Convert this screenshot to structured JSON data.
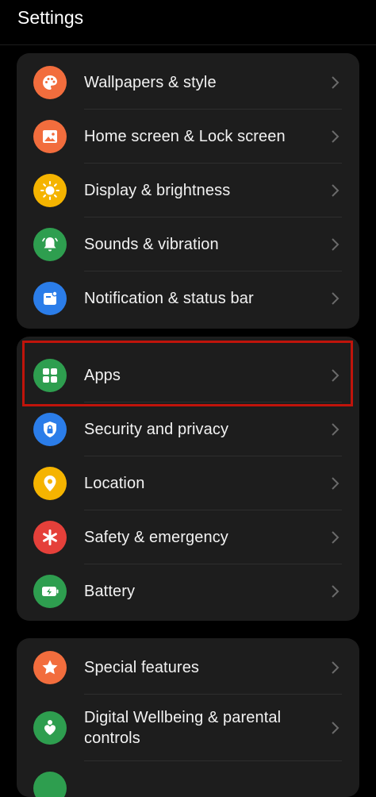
{
  "header": {
    "title": "Settings"
  },
  "groups": [
    {
      "items": [
        {
          "label": "Wallpapers & style",
          "icon": "palette-icon",
          "color": "#f26d3d"
        },
        {
          "label": "Home screen & Lock screen",
          "icon": "image-icon",
          "color": "#f26d3d"
        },
        {
          "label": "Display & brightness",
          "icon": "sun-icon",
          "color": "#f5b400"
        },
        {
          "label": "Sounds & vibration",
          "icon": "bell-icon",
          "color": "#2e9e4f"
        },
        {
          "label": "Notification & status bar",
          "icon": "notification-icon",
          "color": "#2b7de9"
        }
      ]
    },
    {
      "items": [
        {
          "label": "Apps",
          "icon": "apps-grid-icon",
          "color": "#2e9e4f"
        },
        {
          "label": "Security and privacy",
          "icon": "shield-lock-icon",
          "color": "#2b7de9"
        },
        {
          "label": "Location",
          "icon": "location-pin-icon",
          "color": "#f5b400"
        },
        {
          "label": "Safety & emergency",
          "icon": "asterisk-icon",
          "color": "#e5403a"
        },
        {
          "label": "Battery",
          "icon": "battery-icon",
          "color": "#2e9e4f"
        }
      ]
    },
    {
      "items": [
        {
          "label": "Special features",
          "icon": "star-icon",
          "color": "#f26d3d"
        },
        {
          "label": "Digital Wellbeing & parental controls",
          "icon": "wellbeing-heart-icon",
          "color": "#2e9e4f"
        },
        {
          "label": "",
          "icon": "more-icon",
          "color": "#2e9e4f"
        }
      ]
    }
  ],
  "highlight_color": "#c0140b"
}
